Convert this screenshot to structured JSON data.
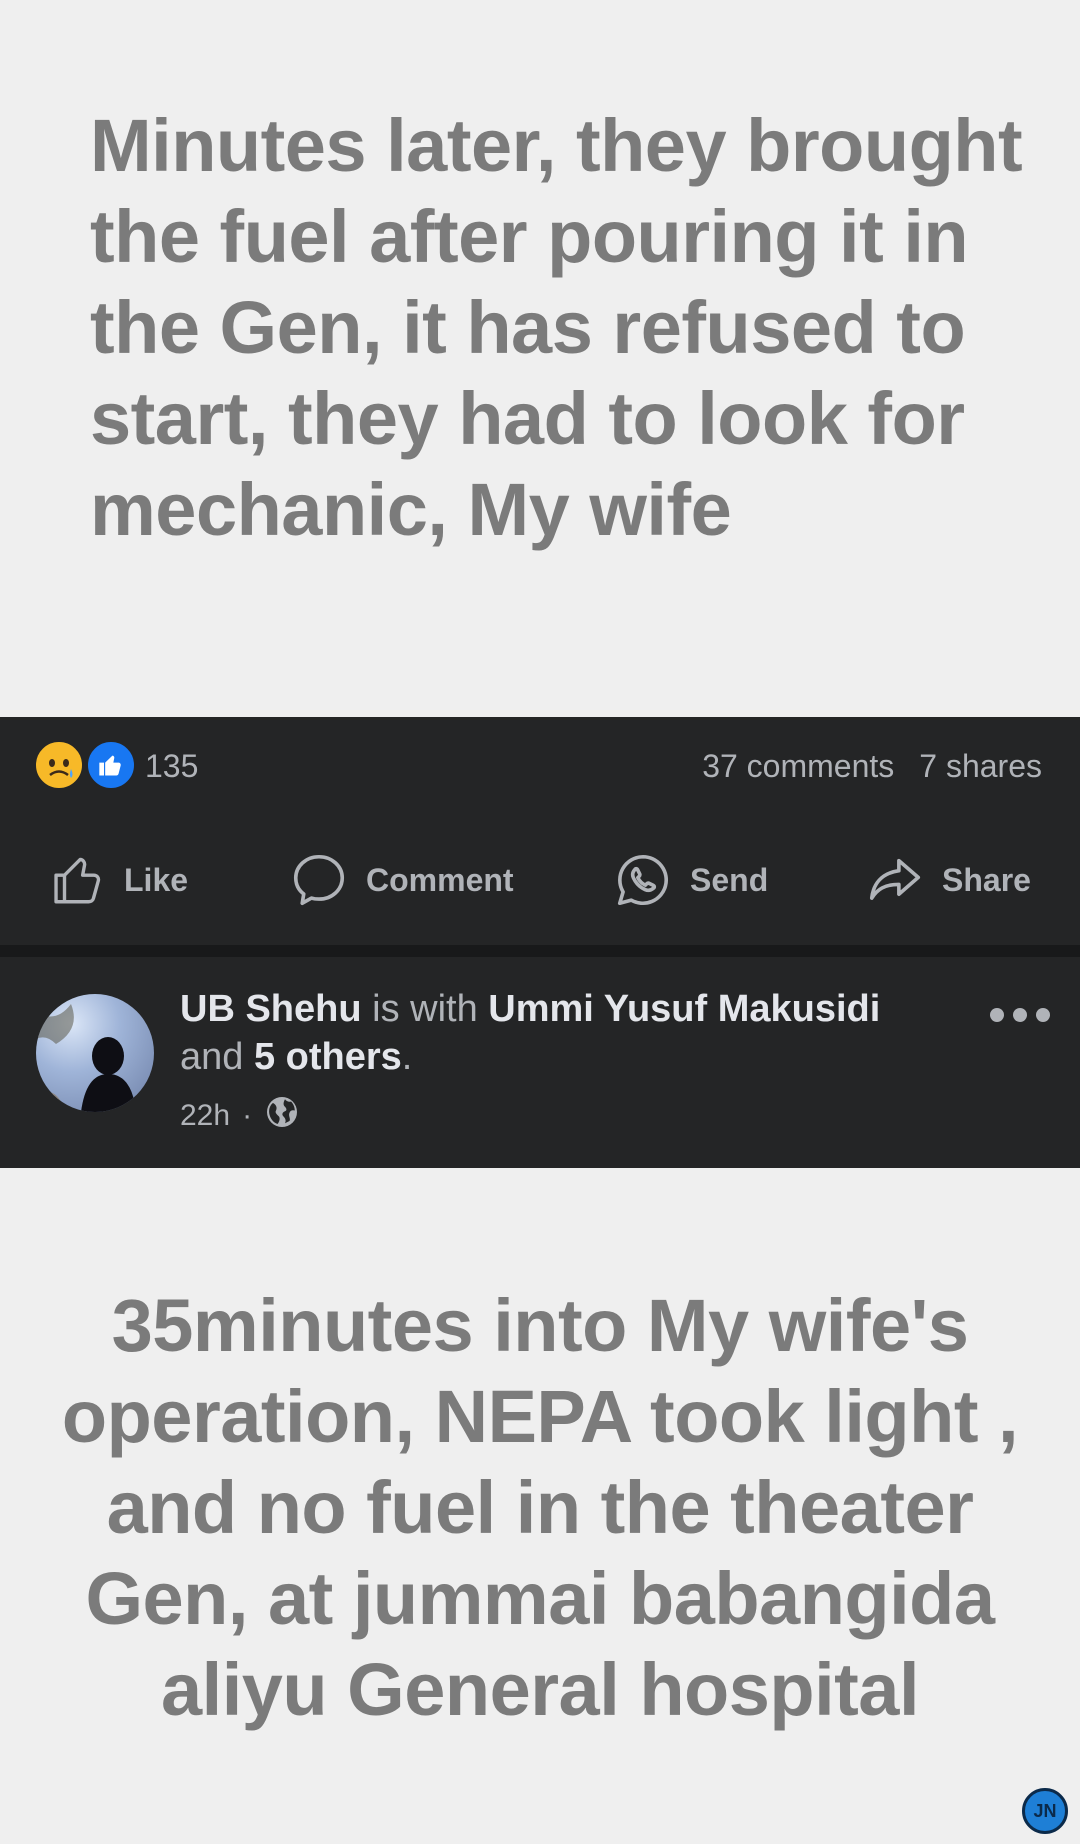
{
  "post1": {
    "text": "Minutes later, they brought the fuel after pouring it in the Gen, it has refused to start, they had to look for mechanic, My wife"
  },
  "stats": {
    "reaction_count": "135",
    "comments": "37 comments",
    "shares": "7 shares",
    "reactions": [
      "sad-reaction-icon",
      "like-reaction-icon"
    ]
  },
  "actions": {
    "like": "Like",
    "comment": "Comment",
    "send": "Send",
    "share": "Share"
  },
  "post2_header": {
    "author": "UB Shehu",
    "is_with": " is with ",
    "tagged": "Ummi Yusuf Makusidi",
    "and": " and ",
    "others": "5 others",
    "period": ".",
    "time": "22h",
    "dot": "·",
    "privacy_icon": "globe-icon"
  },
  "post2": {
    "text": "35minutes into My wife's operation, NEPA took light , and no fuel in the theater Gen, at jummai babangida aliyu General hospital"
  },
  "watermark": {
    "text": "JN"
  },
  "colors": {
    "background_light": "#efefef",
    "text_gray": "#7b7b7b",
    "dark_bar": "#242526",
    "muted_text": "#b0b3b8",
    "bright_text": "#e4e6eb",
    "like_blue": "#1877f2"
  }
}
